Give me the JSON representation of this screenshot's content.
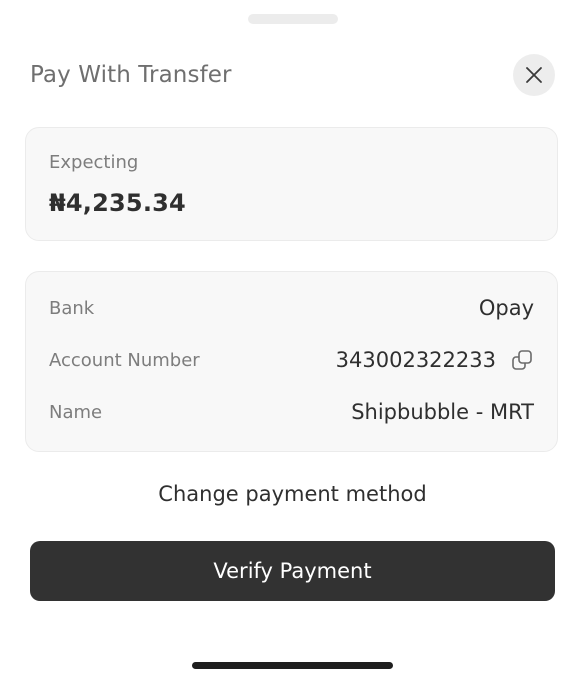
{
  "sheet": {
    "title": "Pay With Transfer",
    "close_icon": "close-icon"
  },
  "expecting": {
    "label": "Expecting",
    "amount": "₦4,235.34"
  },
  "details": {
    "bank_label": "Bank",
    "bank_value": "Opay",
    "account_label": "Account Number",
    "account_value": "343002322233",
    "copy_icon": "copy-icon",
    "name_label": "Name",
    "name_value": "Shipbubble - MRT"
  },
  "actions": {
    "change_method": "Change payment method",
    "verify": "Verify Payment"
  },
  "colors": {
    "primary_button": "#323232",
    "card_background": "#f8f8f8"
  }
}
